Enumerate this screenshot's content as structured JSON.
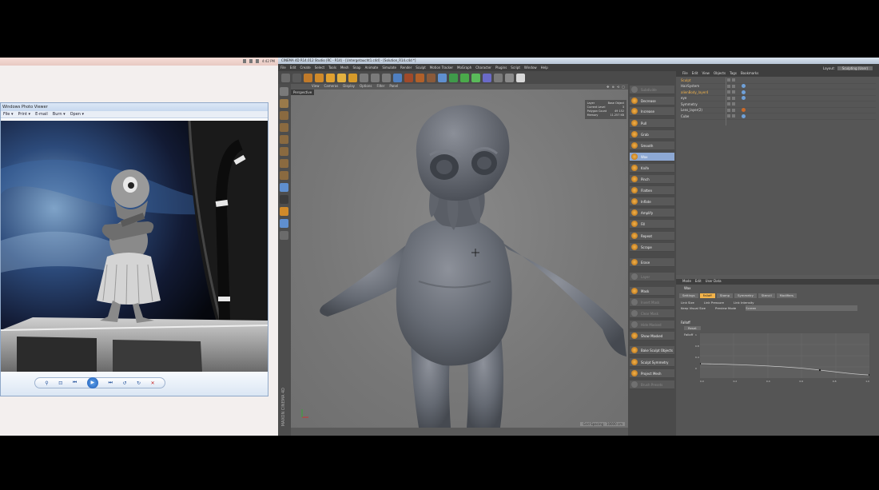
{
  "photo_viewer": {
    "taskbar_time": "4:42 PM",
    "window_title": "Windows Photo Viewer",
    "menu_file": "File ▾",
    "menu_print": "Print ▾",
    "menu_email": "E-mail",
    "menu_burn": "Burn ▾",
    "menu_open": "Open ▾",
    "help": "?",
    "controls": [
      "⚲",
      "⊡",
      "⏮",
      "▶",
      "⏭",
      "↺",
      "↻",
      "✕"
    ]
  },
  "c4d": {
    "title": "CINEMA 4D R14.012 Studio (RC - R14) - [Untergetaucht1.c4d] - [Solution_R14.c4d *]",
    "menu": [
      "File",
      "Edit",
      "Create",
      "Select",
      "Tools",
      "Mesh",
      "Snap",
      "Animate",
      "Simulate",
      "Render",
      "Sculpt",
      "Motion Tracker",
      "MoGraph",
      "Character",
      "Plugins",
      "Script",
      "Window",
      "Help"
    ],
    "layout_label": "Layout:",
    "layout_value": "Sculpting (User)",
    "viewport": {
      "menu": [
        "View",
        "Cameras",
        "Display",
        "Options",
        "Filter",
        "Panel"
      ],
      "name": "Perspective",
      "info": [
        {
          "k": "Layer",
          "v": "Base Object"
        },
        {
          "k": "Current Level",
          "v": "3"
        },
        {
          "k": "Polygon Count",
          "v": "49 152"
        },
        {
          "k": "Memory",
          "v": "11.257 KB"
        }
      ],
      "grid_spacing": "Grid Spacing : 10000 cm",
      "vertical_label": "MAXON CINEMA 4D"
    },
    "tools": [
      {
        "label": "Subdivide",
        "dim": true
      },
      {
        "label": "Decrease",
        "dim": false
      },
      {
        "label": "Increase",
        "dim": false
      },
      {
        "label": "Pull",
        "dim": false
      },
      {
        "label": "Grab",
        "dim": false
      },
      {
        "label": "Smooth",
        "dim": false
      },
      {
        "label": "Wax",
        "dim": false,
        "active": true
      },
      {
        "label": "Knife",
        "dim": false
      },
      {
        "label": "Pinch",
        "dim": false
      },
      {
        "label": "Flatten",
        "dim": false
      },
      {
        "label": "Inflate",
        "dim": false
      },
      {
        "label": "Amplify",
        "dim": false
      },
      {
        "label": "Fill",
        "dim": false
      },
      {
        "label": "Repeat",
        "dim": false
      },
      {
        "label": "Scrape",
        "dim": false
      },
      {
        "label": "Erase",
        "dim": false
      },
      {
        "label": "Layer",
        "dim": true
      },
      {
        "label": "Mask",
        "dim": false
      },
      {
        "label": "Invert Mask",
        "dim": true
      },
      {
        "label": "Clear Mask",
        "dim": true
      },
      {
        "label": "Hide Masked",
        "dim": true
      },
      {
        "label": "Show Masked",
        "dim": false
      },
      {
        "label": "Bake Sculpt Objects",
        "dim": false
      },
      {
        "label": "Sculpt Symmetry",
        "dim": false
      },
      {
        "label": "Project Mesh",
        "dim": false
      },
      {
        "label": "Brush Presets",
        "dim": true
      }
    ],
    "object_manager": {
      "menu": [
        "File",
        "Edit",
        "View",
        "Objects",
        "Tags",
        "Bookmarks"
      ],
      "rows": [
        {
          "name": "Sculpt",
          "sel": true
        },
        {
          "name": "HairSystem",
          "sel": false
        },
        {
          "name": "alienBody_layer4",
          "sel": true
        },
        {
          "name": "eye",
          "sel": false
        },
        {
          "name": "Symmetry",
          "sel": false
        },
        {
          "name": "Lens_layer(2)",
          "sel": false
        },
        {
          "name": "Cube",
          "sel": false
        }
      ]
    },
    "attribute_manager": {
      "menu": [
        "Mode",
        "Edit",
        "User Data"
      ],
      "title": "Wax",
      "tabs": [
        "Settings",
        "Falloff",
        "Stamp",
        "Symmetry",
        "Stencil",
        "Modifiers"
      ],
      "active_tab": "Falloff",
      "opt1_a": "Link Size",
      "opt1_b": "Link Pressure",
      "opt1_c": "Link Intensity",
      "opt2_a": "Keep Visual Size",
      "opt2_b": "Preview Mode",
      "opt2_val": "Screen",
      "falloff_header": "Falloff",
      "reset": "Reset",
      "falloff_label": "Falloff",
      "y_ticks": [
        "1",
        "0.8",
        "0.4",
        "0"
      ],
      "x_ticks": [
        "0.0",
        "0.2",
        "0.4",
        "0.6",
        "0.8",
        "1.0"
      ]
    }
  }
}
